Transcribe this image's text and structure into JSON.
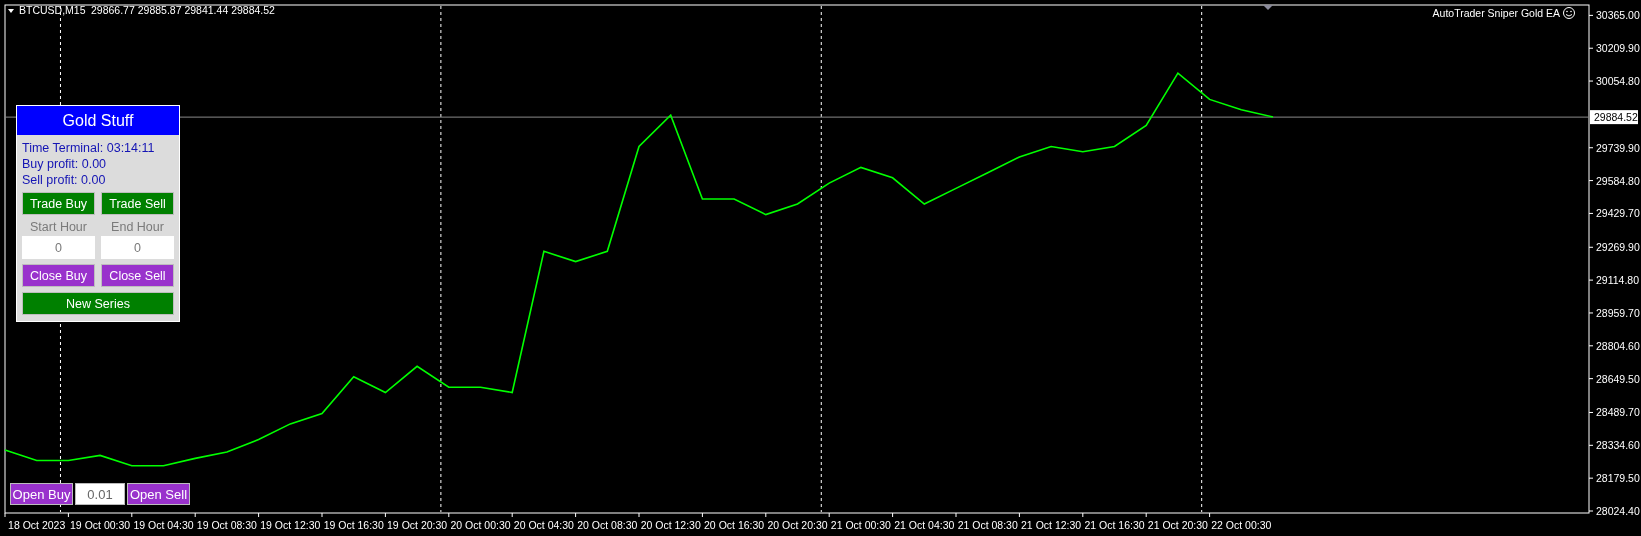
{
  "chart_header": {
    "symbol": "BTCUSD,M15",
    "ohlc": "29866.77 29885.87 29841.44 29884.52"
  },
  "expert_label": "AutoTrader Sniper Gold EA",
  "chart": {
    "chart_data": {
      "type": "line",
      "categories": [
        null,
        "18 Oct 2023",
        null,
        "19 Oct 00:30",
        null,
        "19 Oct 04:30",
        null,
        "19 Oct 08:30",
        null,
        "19 Oct 12:30",
        null,
        "19 Oct 16:30",
        null,
        "19 Oct 20:30",
        null,
        "20 Oct 00:30",
        null,
        "20 Oct 04:30",
        null,
        "20 Oct 08:30",
        null,
        "20 Oct 12:30",
        null,
        "20 Oct 16:30",
        null,
        "20 Oct 20:30",
        null,
        "21 Oct 00:30",
        null,
        "21 Oct 04:30",
        null,
        "21 Oct 08:30",
        null,
        "21 Oct 12:30",
        null,
        "21 Oct 16:30",
        null,
        "21 Oct 20:30",
        null,
        "22 Oct 00:30",
        null
      ],
      "series": [
        {
          "color": "#00ff00",
          "values": [
            28312,
            28263,
            28263,
            28287,
            28238,
            28238,
            28273,
            28303,
            28362,
            28436,
            28485,
            28658,
            28584,
            28708,
            28609,
            28609,
            28584,
            29251,
            29202,
            29251,
            29746,
            29894,
            29498,
            29498,
            29424,
            29474,
            29573,
            29647,
            29598,
            29474,
            29548,
            29622,
            29696,
            29746,
            29721,
            29746,
            29845,
            30092,
            29968,
            29919,
            29885
          ]
        }
      ],
      "ylim": [
        28015,
        30414
      ],
      "ref_lines": [
        {
          "axis": "y",
          "value": 29884.52,
          "label": "29884.52",
          "color": "#8a8a8a"
        }
      ],
      "yticks": [
        {
          "value": 30365,
          "label": "30365.00"
        },
        {
          "value": 30209.9,
          "label": "30209.90"
        },
        {
          "value": 30054.8,
          "label": "30054.80"
        },
        {
          "value": 29739.9,
          "label": "29739.90"
        },
        {
          "value": 29584.8,
          "label": "29584.80"
        },
        {
          "value": 29429.7,
          "label": "29429.70"
        },
        {
          "value": 29269.9,
          "label": "29269.90"
        },
        {
          "value": 29114.8,
          "label": "29114.80"
        },
        {
          "value": 28959.7,
          "label": "28959.70"
        },
        {
          "value": 28804.6,
          "label": "28804.60"
        },
        {
          "value": 28649.5,
          "label": "28649.50"
        },
        {
          "value": 28489.7,
          "label": "28489.70"
        },
        {
          "value": 28334.6,
          "label": "28334.60"
        },
        {
          "value": 28179.5,
          "label": "28179.50"
        },
        {
          "value": 28024.4,
          "label": "28024.40"
        }
      ]
    }
  },
  "panel": {
    "title": "Gold Stuff",
    "time_terminal": "Time Terminal: 03:14:11",
    "buy_profit": "Buy profit: 0.00",
    "sell_profit": "Sell profit: 0.00",
    "trade_buttons": [
      "Trade Buy",
      "Trade Sell"
    ],
    "hour_fields": [
      {
        "label": "Start Hour",
        "value": "0"
      },
      {
        "label": "End Hour",
        "value": "0"
      }
    ],
    "close_buttons": [
      "Close Buy",
      "Close Sell"
    ],
    "new_series": "New Series"
  },
  "quick_trade": {
    "open_buy": "Open Buy",
    "lot": "0.01",
    "open_sell": "Open Sell"
  }
}
